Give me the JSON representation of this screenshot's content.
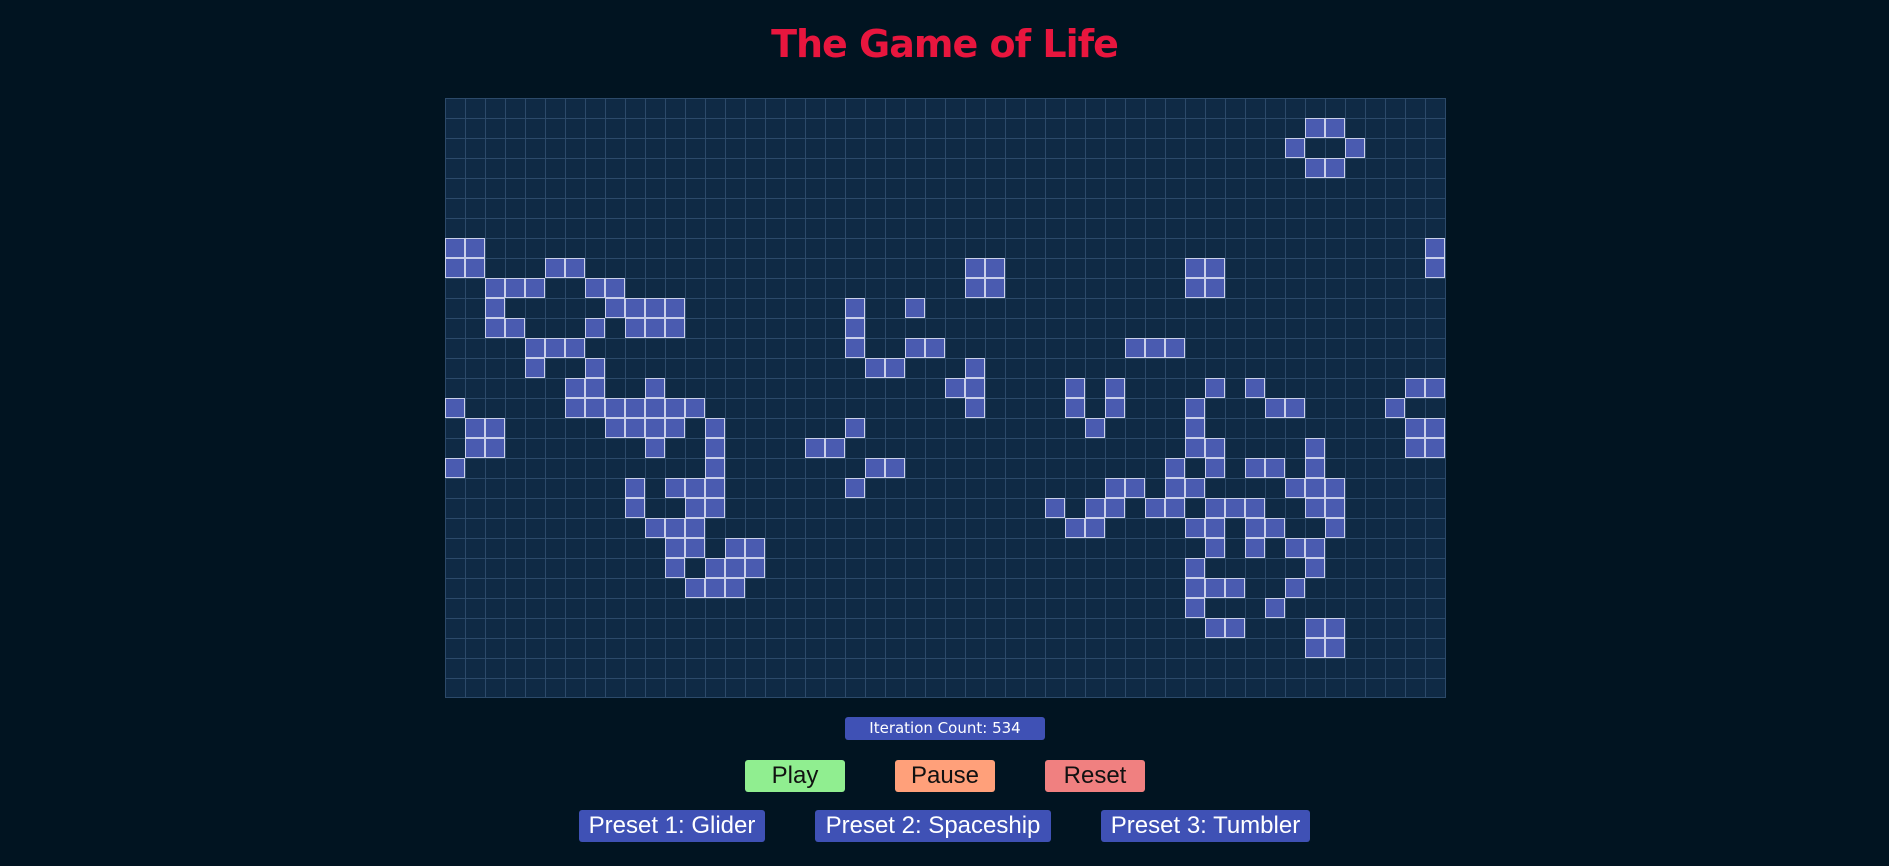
{
  "title": "The Game of Life",
  "iteration": {
    "label": "Iteration Count:",
    "count": 534
  },
  "controls": {
    "play": "Play",
    "pause": "Pause",
    "reset": "Reset"
  },
  "presets": [
    "Preset 1: Glider",
    "Preset 2: Spaceship",
    "Preset 3: Tumbler"
  ],
  "colors": {
    "title": "#e8163e",
    "alive_cell": "#4a5bb0",
    "dead_cell": "#0f2a45",
    "play": "#90ee90",
    "pause": "#ffa07a",
    "reset": "#f08080",
    "preset": "#3f51b5"
  },
  "board": {
    "columns": 50,
    "rows": 30,
    "alive": [
      [
        1,
        43
      ],
      [
        1,
        44
      ],
      [
        2,
        42
      ],
      [
        2,
        45
      ],
      [
        3,
        43
      ],
      [
        3,
        44
      ],
      [
        7,
        0
      ],
      [
        7,
        1
      ],
      [
        7,
        49
      ],
      [
        8,
        0
      ],
      [
        8,
        1
      ],
      [
        8,
        5
      ],
      [
        8,
        6
      ],
      [
        8,
        26
      ],
      [
        8,
        27
      ],
      [
        8,
        37
      ],
      [
        8,
        38
      ],
      [
        8,
        49
      ],
      [
        9,
        2
      ],
      [
        9,
        3
      ],
      [
        9,
        4
      ],
      [
        9,
        7
      ],
      [
        9,
        8
      ],
      [
        9,
        26
      ],
      [
        9,
        27
      ],
      [
        9,
        37
      ],
      [
        9,
        38
      ],
      [
        10,
        2
      ],
      [
        10,
        8
      ],
      [
        10,
        9
      ],
      [
        10,
        10
      ],
      [
        10,
        11
      ],
      [
        10,
        20
      ],
      [
        10,
        23
      ],
      [
        11,
        2
      ],
      [
        11,
        3
      ],
      [
        11,
        7
      ],
      [
        11,
        9
      ],
      [
        11,
        10
      ],
      [
        11,
        11
      ],
      [
        11,
        20
      ],
      [
        12,
        4
      ],
      [
        12,
        5
      ],
      [
        12,
        6
      ],
      [
        12,
        20
      ],
      [
        12,
        23
      ],
      [
        12,
        24
      ],
      [
        12,
        34
      ],
      [
        12,
        35
      ],
      [
        12,
        36
      ],
      [
        13,
        4
      ],
      [
        13,
        7
      ],
      [
        13,
        21
      ],
      [
        13,
        22
      ],
      [
        13,
        26
      ],
      [
        14,
        6
      ],
      [
        14,
        7
      ],
      [
        14,
        10
      ],
      [
        14,
        25
      ],
      [
        14,
        26
      ],
      [
        14,
        31
      ],
      [
        14,
        33
      ],
      [
        14,
        38
      ],
      [
        14,
        40
      ],
      [
        14,
        48
      ],
      [
        14,
        49
      ],
      [
        15,
        0
      ],
      [
        15,
        6
      ],
      [
        15,
        7
      ],
      [
        15,
        8
      ],
      [
        15,
        9
      ],
      [
        15,
        10
      ],
      [
        15,
        11
      ],
      [
        15,
        12
      ],
      [
        15,
        26
      ],
      [
        15,
        31
      ],
      [
        15,
        33
      ],
      [
        15,
        37
      ],
      [
        15,
        41
      ],
      [
        15,
        42
      ],
      [
        15,
        47
      ],
      [
        16,
        1
      ],
      [
        16,
        2
      ],
      [
        16,
        8
      ],
      [
        16,
        9
      ],
      [
        16,
        10
      ],
      [
        16,
        11
      ],
      [
        16,
        13
      ],
      [
        16,
        20
      ],
      [
        16,
        32
      ],
      [
        16,
        37
      ],
      [
        16,
        48
      ],
      [
        16,
        49
      ],
      [
        17,
        1
      ],
      [
        17,
        2
      ],
      [
        17,
        10
      ],
      [
        17,
        13
      ],
      [
        17,
        18
      ],
      [
        17,
        19
      ],
      [
        17,
        37
      ],
      [
        17,
        38
      ],
      [
        17,
        43
      ],
      [
        17,
        48
      ],
      [
        17,
        49
      ],
      [
        18,
        0
      ],
      [
        18,
        13
      ],
      [
        18,
        21
      ],
      [
        18,
        22
      ],
      [
        18,
        36
      ],
      [
        18,
        38
      ],
      [
        18,
        40
      ],
      [
        18,
        41
      ],
      [
        18,
        43
      ],
      [
        19,
        9
      ],
      [
        19,
        11
      ],
      [
        19,
        12
      ],
      [
        19,
        13
      ],
      [
        19,
        20
      ],
      [
        19,
        33
      ],
      [
        19,
        34
      ],
      [
        19,
        36
      ],
      [
        19,
        37
      ],
      [
        19,
        42
      ],
      [
        19,
        43
      ],
      [
        19,
        44
      ],
      [
        20,
        9
      ],
      [
        20,
        12
      ],
      [
        20,
        13
      ],
      [
        20,
        30
      ],
      [
        20,
        32
      ],
      [
        20,
        33
      ],
      [
        20,
        35
      ],
      [
        20,
        36
      ],
      [
        20,
        38
      ],
      [
        20,
        39
      ],
      [
        20,
        40
      ],
      [
        20,
        43
      ],
      [
        20,
        44
      ],
      [
        21,
        10
      ],
      [
        21,
        11
      ],
      [
        21,
        12
      ],
      [
        21,
        31
      ],
      [
        21,
        32
      ],
      [
        21,
        37
      ],
      [
        21,
        38
      ],
      [
        21,
        40
      ],
      [
        21,
        41
      ],
      [
        21,
        44
      ],
      [
        22,
        11
      ],
      [
        22,
        12
      ],
      [
        22,
        14
      ],
      [
        22,
        15
      ],
      [
        22,
        38
      ],
      [
        22,
        40
      ],
      [
        22,
        42
      ],
      [
        22,
        43
      ],
      [
        23,
        11
      ],
      [
        23,
        13
      ],
      [
        23,
        14
      ],
      [
        23,
        15
      ],
      [
        23,
        37
      ],
      [
        23,
        43
      ],
      [
        24,
        12
      ],
      [
        24,
        13
      ],
      [
        24,
        14
      ],
      [
        24,
        37
      ],
      [
        24,
        38
      ],
      [
        24,
        39
      ],
      [
        24,
        42
      ],
      [
        25,
        37
      ],
      [
        25,
        41
      ],
      [
        26,
        38
      ],
      [
        26,
        39
      ],
      [
        26,
        43
      ],
      [
        26,
        44
      ],
      [
        27,
        43
      ],
      [
        27,
        44
      ]
    ]
  }
}
